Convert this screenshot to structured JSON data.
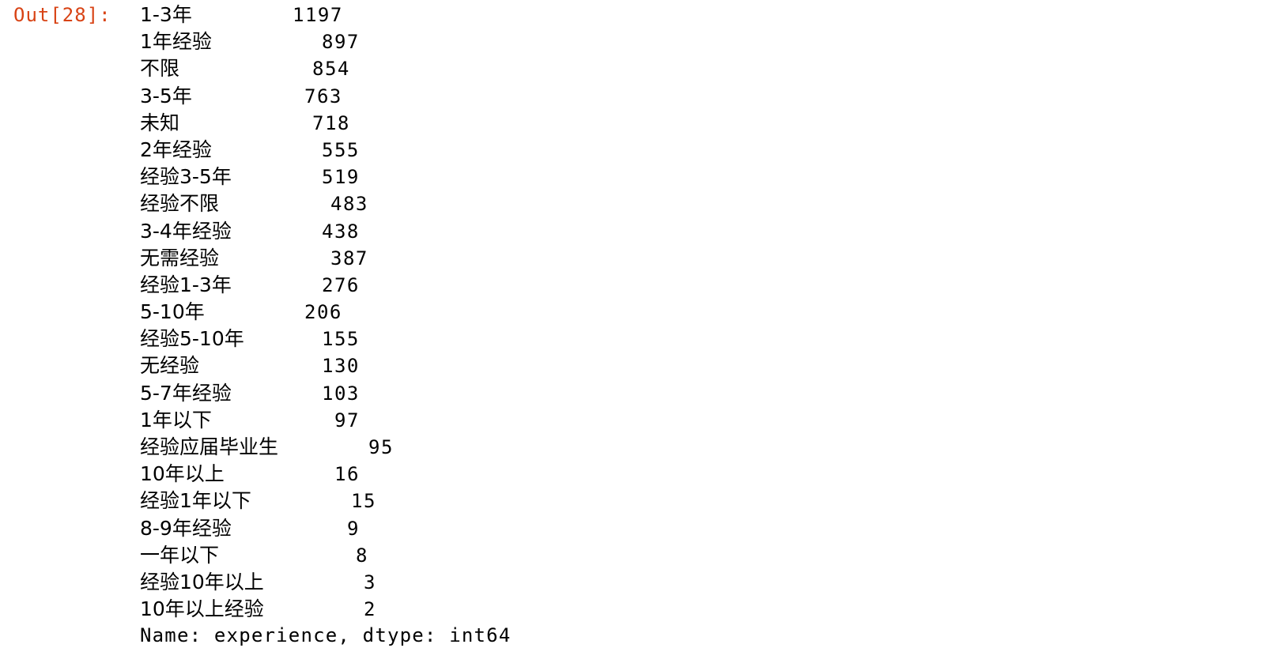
{
  "prompt": "Out[28]:",
  "series": [
    {
      "label": "1-3年",
      "value": "1197"
    },
    {
      "label": "1年经验",
      "value": "897"
    },
    {
      "label": "不限",
      "value": "854"
    },
    {
      "label": "3-5年",
      "value": "763"
    },
    {
      "label": "未知",
      "value": "718"
    },
    {
      "label": "2年经验",
      "value": "555"
    },
    {
      "label": "经验3-5年",
      "value": "519"
    },
    {
      "label": "经验不限",
      "value": "483"
    },
    {
      "label": "3-4年经验",
      "value": "438"
    },
    {
      "label": "无需经验",
      "value": "387"
    },
    {
      "label": "经验1-3年",
      "value": "276"
    },
    {
      "label": "5-10年",
      "value": "206"
    },
    {
      "label": "经验5-10年",
      "value": "155"
    },
    {
      "label": "无经验",
      "value": "130"
    },
    {
      "label": "5-7年经验",
      "value": "103"
    },
    {
      "label": "1年以下",
      "value": "97"
    },
    {
      "label": "经验应届毕业生",
      "value": "95"
    },
    {
      "label": "10年以上",
      "value": "16"
    },
    {
      "label": "经验1年以下",
      "value": "15"
    },
    {
      "label": "8-9年经验",
      "value": "9"
    },
    {
      "label": "一年以下",
      "value": "8"
    },
    {
      "label": "经验10年以上",
      "value": "3"
    },
    {
      "label": "10年以上经验",
      "value": "2"
    }
  ],
  "footer": "Name: experience, dtype: int64"
}
